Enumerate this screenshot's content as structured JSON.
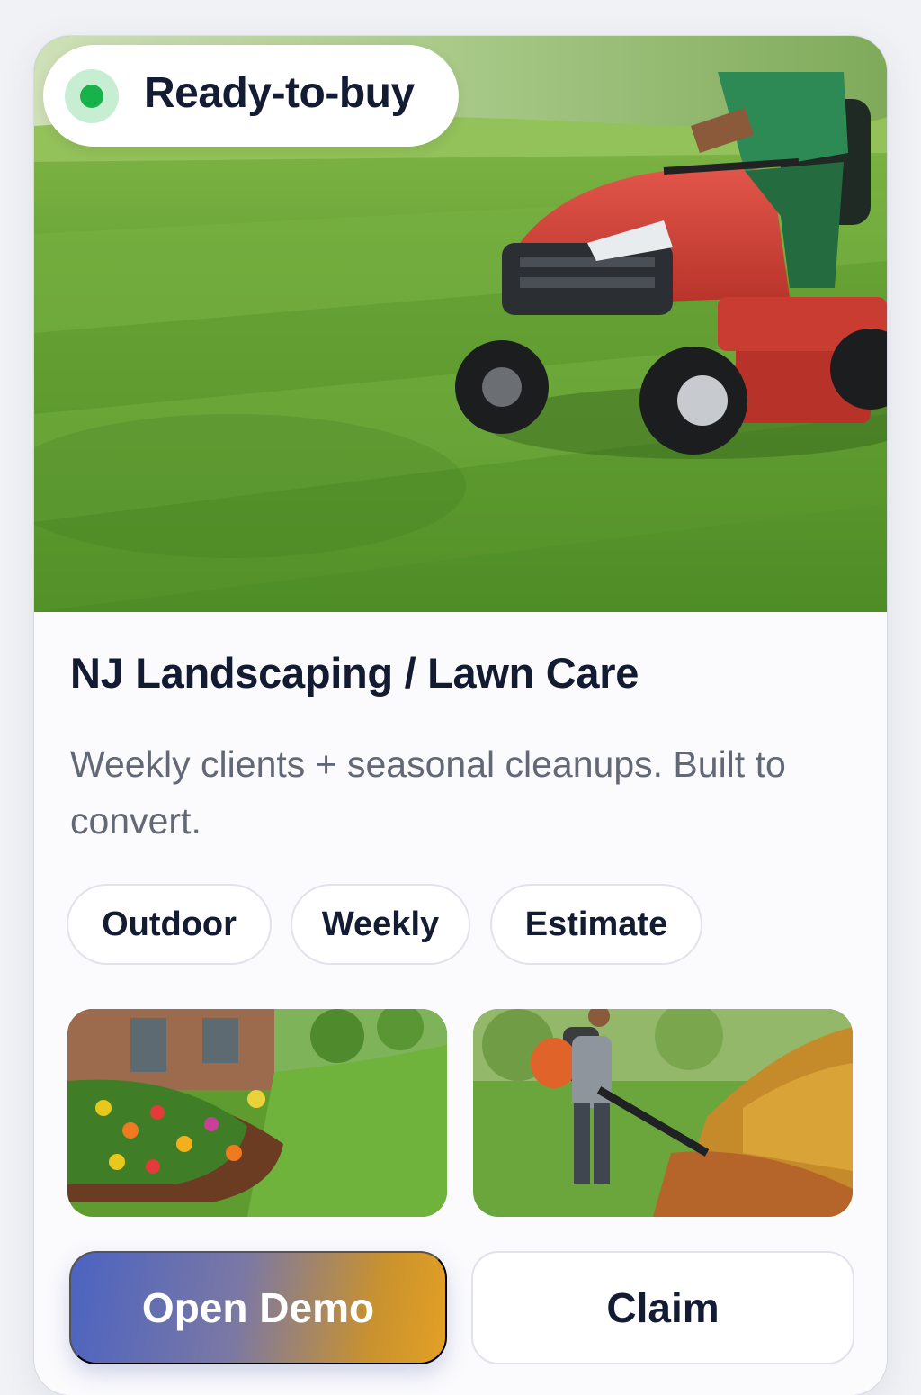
{
  "listing": {
    "status": {
      "label": "Ready-to-buy",
      "dot_color": "#18b24a",
      "icon": "status-dot-icon"
    },
    "hero_image": "riding-lawn-mower-on-striped-grass",
    "title": "NJ Landscaping / Lawn Care",
    "description": "Weekly clients + seasonal cleanups. Built to convert.",
    "tags": [
      "Outdoor",
      "Weekly",
      "Estimate"
    ],
    "thumbnails": [
      "flower-bed-landscaping",
      "leaf-blower-cleanup"
    ],
    "actions": {
      "primary_label": "Open Demo",
      "secondary_label": "Claim"
    }
  },
  "colors": {
    "title_text": "#131b33",
    "body_text": "#626876",
    "gradient_start": "#4b63c1",
    "gradient_end": "#e3a024",
    "lawn_green": "#5e9c2f",
    "mower_red": "#d9473a"
  }
}
